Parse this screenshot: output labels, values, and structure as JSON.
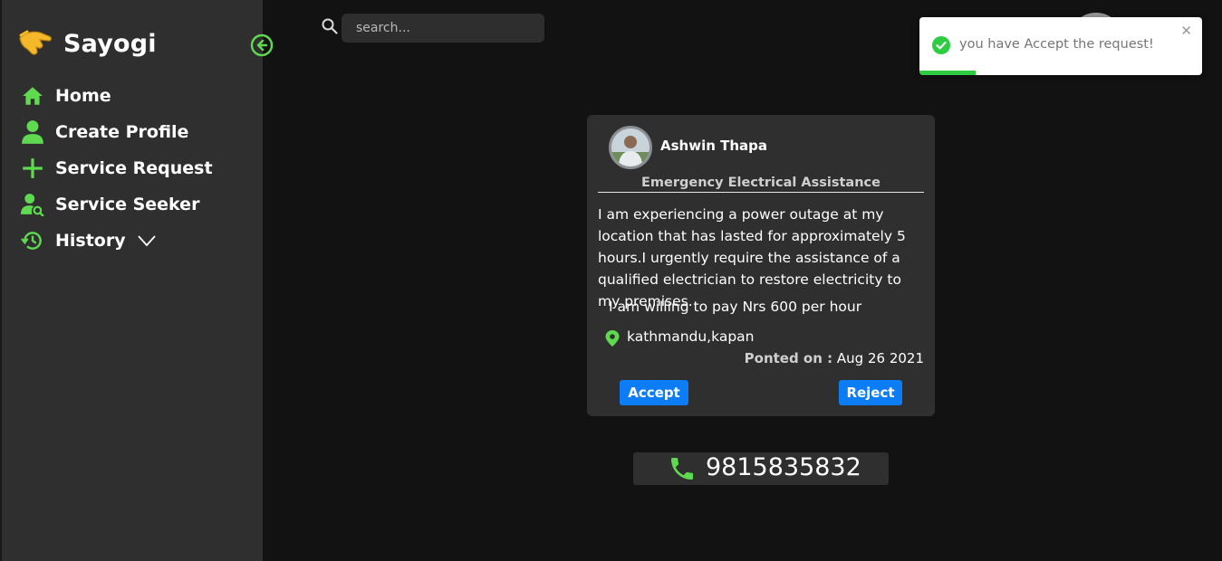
{
  "app": {
    "name": "Sayogi"
  },
  "sidebar": {
    "items": [
      {
        "label": "Home",
        "icon": "home-icon"
      },
      {
        "label": "Create Profile",
        "icon": "user-icon"
      },
      {
        "label": "Service Request",
        "icon": "plus-icon"
      },
      {
        "label": "Service Seeker",
        "icon": "user-search-icon"
      },
      {
        "label": "History",
        "icon": "history-icon"
      }
    ]
  },
  "search": {
    "placeholder": "search..."
  },
  "toast": {
    "message": "you have Accept the request!",
    "close": "✕",
    "progress": 0.2
  },
  "card": {
    "name": "Ashwin Thapa",
    "title": "Emergency Electrical Assistance",
    "description": "I am experiencing a power outage at my location that has lasted for approximately 5 hours.I urgently require the assistance of a qualified electrician to restore electricity to my premises.",
    "payment": "I am willing to pay Nrs 600 per hour",
    "location": "kathmandu,kapan",
    "posted_label": "Ponted on :",
    "posted_date": " Aug 26 2021",
    "accept": "Accept",
    "reject": "Reject"
  },
  "phone": {
    "number": "9815835832"
  },
  "colors": {
    "accent": "#5fd94f",
    "button": "#0d7df5",
    "sidebar": "#2f2f2f",
    "background": "#121212"
  }
}
